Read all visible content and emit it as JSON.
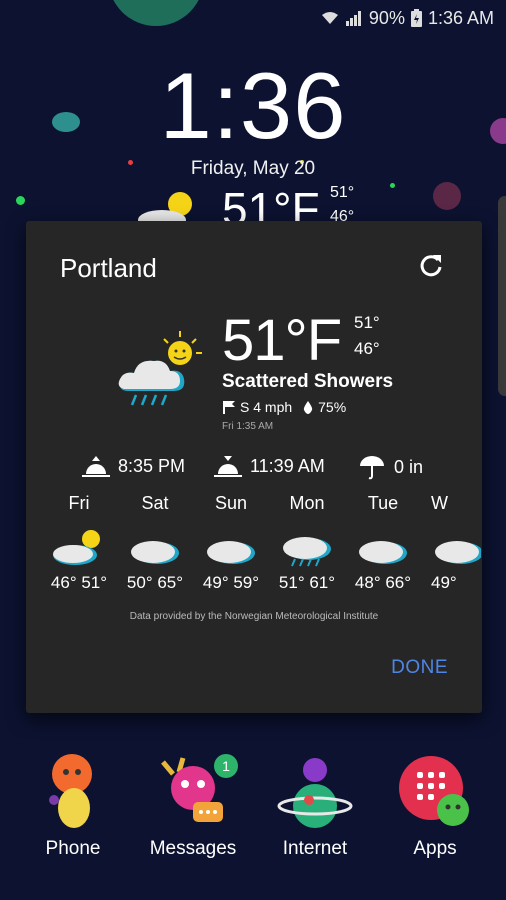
{
  "status_bar": {
    "battery": "90%",
    "time": "1:36 AM"
  },
  "lockscreen": {
    "clock": "1:36",
    "date": "Friday, May 20",
    "bg_temp": "51°F",
    "bg_hi": "51°",
    "bg_lo": "46°"
  },
  "weather_dialog": {
    "city": "Portland",
    "current": {
      "temp": "51°F",
      "hi": "51°",
      "lo": "46°",
      "condition": "Scattered Showers",
      "wind": "S 4 mph",
      "humidity": "75%",
      "updated": "Fri 1:35 AM"
    },
    "sunset": "8:35 PM",
    "moonrise": "11:39 AM",
    "precip": "0 in",
    "forecast": [
      {
        "day": "Fri",
        "temps": "46° 51°",
        "icon": "partly-cloudy-icon"
      },
      {
        "day": "Sat",
        "temps": "50° 65°",
        "icon": "cloud-icon"
      },
      {
        "day": "Sun",
        "temps": "49° 59°",
        "icon": "cloud-icon"
      },
      {
        "day": "Mon",
        "temps": "51° 61°",
        "icon": "rain-cloud-icon"
      },
      {
        "day": "Tue",
        "temps": "48° 66°",
        "icon": "cloud-icon"
      },
      {
        "day": "W",
        "temps": "49°",
        "icon": "cloud-icon"
      }
    ],
    "credit": "Data provided by the Norwegian Meteorological Institute",
    "done_label": "DONE"
  },
  "dock": {
    "apps": [
      {
        "label": "Phone"
      },
      {
        "label": "Messages",
        "badge": "1"
      },
      {
        "label": "Internet"
      },
      {
        "label": "Apps"
      }
    ]
  },
  "colors": {
    "accent": "#4f86e6",
    "dialog_bg": "#262626",
    "wallpaper": "#0c1230"
  }
}
